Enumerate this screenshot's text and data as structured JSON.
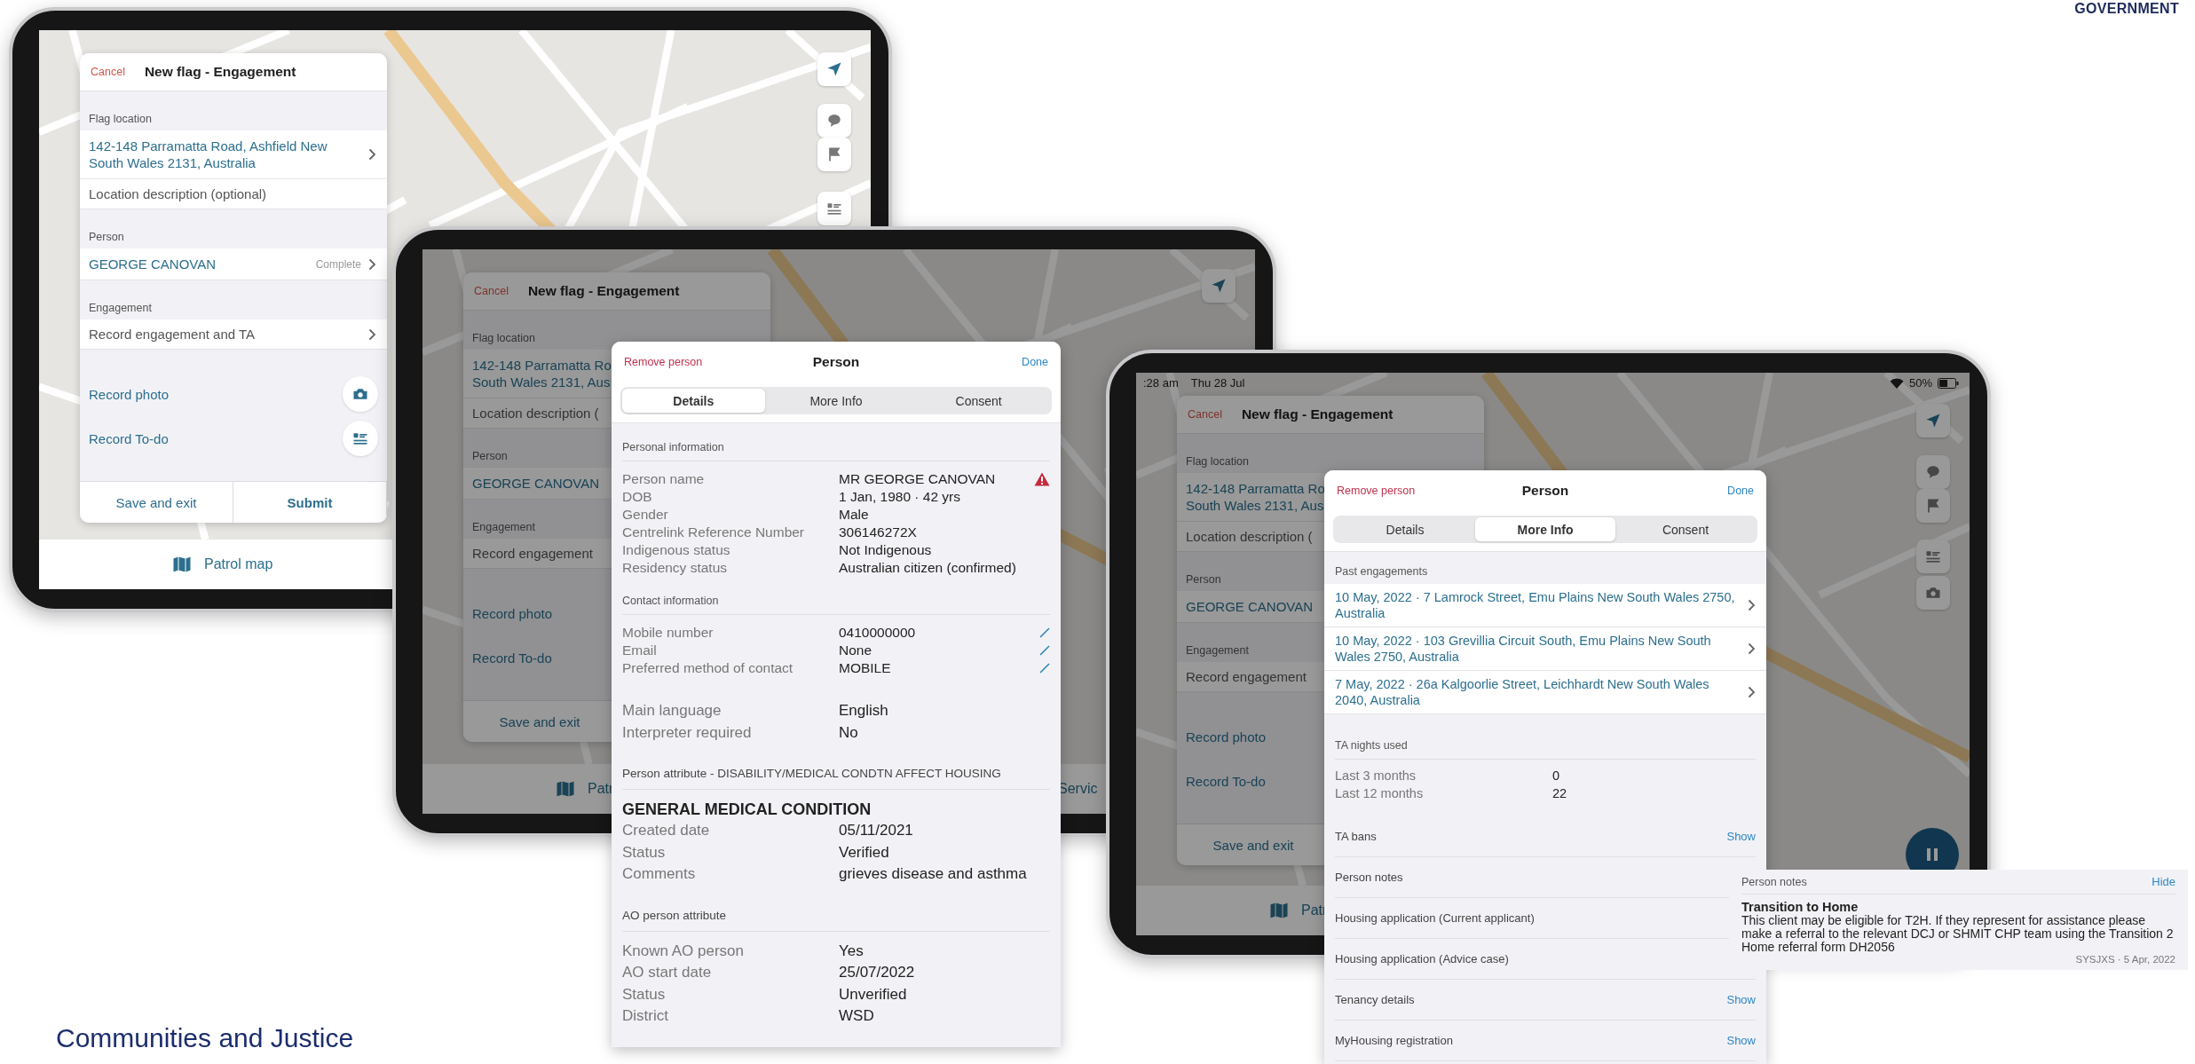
{
  "logo": {
    "text": "GOVERNMENT"
  },
  "tablet_1": {
    "dimmed": false,
    "form": {
      "cancel": "Cancel",
      "title": "New flag - Engagement",
      "action_icons": true,
      "sections": [
        {
          "heading": "Flag location",
          "rows": [
            {
              "kind": "link",
              "lines": [
                "142-148 Parramatta Road, Ashfield New",
                "South Wales 2131, Australia"
              ],
              "chevron": true
            },
            {
              "kind": "field",
              "placeholder": "Location description (optional)"
            }
          ]
        },
        {
          "heading": "Person",
          "rows": [
            {
              "kind": "link",
              "lines": [
                "GEORGE CANOVAN"
              ],
              "status": "Complete",
              "chevron": true
            }
          ]
        },
        {
          "heading": "Engagement",
          "rows": [
            {
              "kind": "plain",
              "lines": [
                "Record engagement and TA"
              ],
              "chevron": true
            }
          ]
        }
      ],
      "actions": [
        "Record photo",
        "Record To-do"
      ],
      "buttons": [
        {
          "label": "Save and exit",
          "primary": false
        },
        {
          "label": "Submit",
          "primary": true
        }
      ]
    },
    "tab_bar": [
      "Patrol map"
    ]
  },
  "tablet_2": {
    "dimmed": true,
    "form": {
      "cancel": "Cancel",
      "title": "New flag - Engagement",
      "sections": [
        {
          "heading": "Flag location",
          "rows": [
            {
              "kind": "link",
              "lines": [
                "142-148 Parramatta Ro",
                "South Wales 2131, Aus"
              ]
            },
            {
              "kind": "field",
              "placeholder": "Location description ("
            }
          ]
        },
        {
          "heading": "Person",
          "rows": [
            {
              "kind": "link",
              "lines": [
                "GEORGE CANOVAN"
              ]
            }
          ]
        },
        {
          "heading": "Engagement",
          "rows": [
            {
              "kind": "plain",
              "lines": [
                "Record engagement"
              ]
            }
          ]
        }
      ],
      "actions": [
        "Record photo",
        "Record To-do"
      ],
      "buttons": [
        {
          "label": "Save and exit",
          "primary": false
        }
      ]
    },
    "tab_bar": [
      "Patr",
      "Servic"
    ]
  },
  "person_modal_details": {
    "left_action": "Remove person",
    "title": "Person",
    "right_action": "Done",
    "tabs": [
      {
        "label": "Details",
        "selected": true
      },
      {
        "label": "More Info",
        "selected": false
      },
      {
        "label": "Consent",
        "selected": false
      }
    ],
    "sections": [
      {
        "kind": "compact",
        "heading": "Personal information",
        "rows": [
          {
            "label": "Person name",
            "value": "MR GEORGE CANOVAN",
            "warning": true,
            "editable": false
          },
          {
            "label": "DOB",
            "value": "1 Jan, 1980 · 42 yrs",
            "warning": false,
            "editable": false
          },
          {
            "label": "Gender",
            "value": "Male",
            "warning": false,
            "editable": false
          },
          {
            "label": "Centrelink Reference Number",
            "value": "306146272X",
            "warning": false,
            "editable": false
          },
          {
            "label": "Indigenous status",
            "value": "Not Indigenous",
            "warning": false,
            "editable": false
          },
          {
            "label": "Residency status",
            "value": "Australian citizen (confirmed)",
            "warning": false,
            "editable": false
          }
        ]
      },
      {
        "kind": "compact",
        "heading": "Contact information",
        "rows": [
          {
            "label": "Mobile number",
            "value": "0410000000",
            "warning": false,
            "editable": true
          },
          {
            "label": "Email",
            "value": "None",
            "warning": false,
            "editable": true
          },
          {
            "label": "Preferred method of contact",
            "value": "MOBILE",
            "warning": false,
            "editable": true
          }
        ]
      },
      {
        "kind": "large",
        "rows": [
          {
            "label": "Main language",
            "value": "English"
          },
          {
            "label": "Interpreter required",
            "value": "No"
          }
        ]
      },
      {
        "kind": "large",
        "heading": "Person attribute - DISABILITY/MEDICAL CONDTN AFFECT HOUSING",
        "subheading": "GENERAL MEDICAL CONDITION",
        "rows": [
          {
            "label": "Created date",
            "value": "05/11/2021"
          },
          {
            "label": "Status",
            "value": "Verified"
          },
          {
            "label": "Comments",
            "value": "grieves disease and asthma"
          }
        ]
      },
      {
        "kind": "large",
        "heading": "AO person attribute",
        "rows": [
          {
            "label": "Known AO person",
            "value": "Yes"
          },
          {
            "label": "AO start date",
            "value": "25/07/2022"
          },
          {
            "label": "Status",
            "value": "Unverified"
          },
          {
            "label": "District",
            "value": "WSD"
          }
        ]
      }
    ]
  },
  "tablet_3": {
    "dimmed": true,
    "status_bar": {
      "time": ":28 am",
      "date": "Thu 28 Jul",
      "battery": "50%"
    },
    "form": {
      "cancel": "Cancel",
      "title": "New flag - Engagement",
      "sections": [
        {
          "heading": "Flag location",
          "rows": [
            {
              "kind": "link",
              "lines": [
                "142-148 Parramatta Ro",
                "South Wales 2131, Aus"
              ]
            },
            {
              "kind": "field",
              "placeholder": "Location description ("
            }
          ]
        },
        {
          "heading": "Person",
          "rows": [
            {
              "kind": "link",
              "lines": [
                "GEORGE CANOVAN"
              ]
            }
          ]
        },
        {
          "heading": "Engagement",
          "rows": [
            {
              "kind": "plain",
              "lines": [
                "Record engagement"
              ]
            }
          ]
        }
      ],
      "actions": [
        "Record photo",
        "Record To-do"
      ],
      "buttons": [
        {
          "label": "Save and exit",
          "primary": false
        }
      ]
    },
    "tab_bar": [
      "Patr"
    ]
  },
  "person_modal_more": {
    "left_action": "Remove person",
    "title": "Person",
    "right_action": "Done",
    "tabs": [
      {
        "label": "Details",
        "selected": false
      },
      {
        "label": "More Info",
        "selected": true
      },
      {
        "label": "Consent",
        "selected": false
      }
    ],
    "past_heading": "Past engagements",
    "past_engagements": [
      "10 May, 2022 · 7 Lamrock Street, Emu Plains New South Wales 2750, Australia",
      "10 May, 2022 · 103 Grevillia Circuit South, Emu Plains New South Wales 2750, Australia",
      "7 May, 2022 · 26a Kalgoorlie Street, Leichhardt New South Wales 2040, Australia"
    ],
    "ta_heading": "TA nights used",
    "ta_rows": [
      {
        "label": "Last 3 months",
        "value": "0"
      },
      {
        "label": "Last 12 months",
        "value": "22"
      }
    ],
    "records": [
      {
        "label": "TA bans",
        "action": "Show"
      },
      {
        "label": "Person notes"
      },
      {
        "label": "Housing application (Current applicant)"
      },
      {
        "label": "Housing application (Advice case)"
      },
      {
        "label": "Tenancy details",
        "action": "Show"
      },
      {
        "label": "MyHousing registration",
        "action": "Show"
      }
    ]
  },
  "notes_popup": {
    "heading": "Person notes",
    "action": "Hide",
    "title": "Transition to Home",
    "body": "This client may be eligible for T2H. If they represent for assistance please make a referral to the relevant DCJ or SHMIT CHP team using the Transition 2 Home referral form DH2056",
    "meta": "SYSJXS · 5 Apr, 2022"
  },
  "footer": {
    "text": "Communities and Justice"
  }
}
